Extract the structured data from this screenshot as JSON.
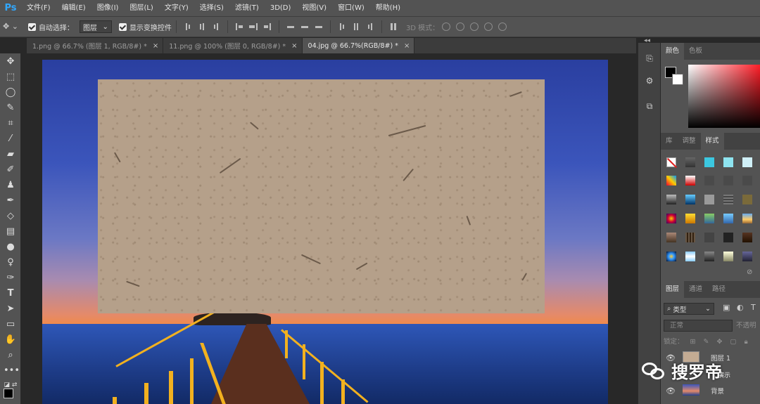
{
  "app": {
    "logo": "Ps"
  },
  "menu": [
    "文件(F)",
    "编辑(E)",
    "图像(I)",
    "图层(L)",
    "文字(Y)",
    "选择(S)",
    "滤镜(T)",
    "3D(D)",
    "视图(V)",
    "窗口(W)",
    "帮助(H)"
  ],
  "options": {
    "auto_select_label": "自动选择：",
    "auto_select_value": "图层",
    "show_transform_label": "显示变换控件",
    "mode_3d_label": "3D 模式："
  },
  "tabs": [
    {
      "label": "1.png @ 66.7% (图层 1, RGB/8#) *",
      "close": "×"
    },
    {
      "label": "11.png @ 100% (图层 0, RGB/8#) *",
      "close": "×"
    },
    {
      "label": "04.jpg @ 66.7%(RGB/8#) *",
      "close": "×"
    }
  ],
  "panels": {
    "color_tabs": [
      "颜色",
      "色板"
    ],
    "style_tabs": [
      "库",
      "调整",
      "样式"
    ],
    "layer_tabs": [
      "图层",
      "通道",
      "路径"
    ],
    "layer_filter": "类型",
    "blend_mode": "正常",
    "opacity_label": "不透明",
    "lock_label": "锁定：",
    "layers": [
      {
        "name": "图层 1"
      },
      {
        "name": "背景"
      }
    ]
  },
  "watermark": {
    "text": "搜罗帝",
    "partial": "演示"
  },
  "colors": {
    "accent": "#31a8ff",
    "panel": "#535353",
    "paper": "#b5a08a"
  }
}
